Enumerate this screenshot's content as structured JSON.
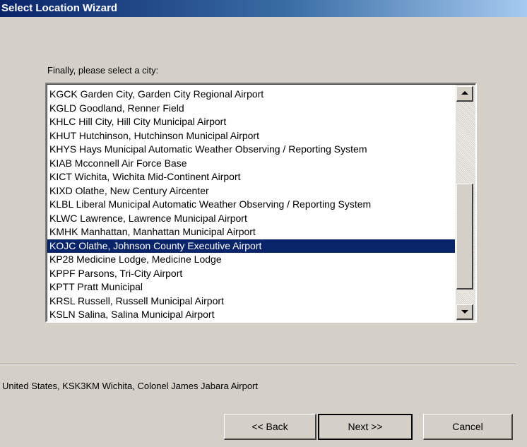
{
  "window": {
    "title": "Select Location Wizard"
  },
  "prompt": "Finally, please select a city:",
  "cities": [
    {
      "label": "KGCK Garden City, Garden City Regional Airport",
      "selected": false
    },
    {
      "label": "KGLD Goodland, Renner Field",
      "selected": false
    },
    {
      "label": "KHLC Hill City, Hill City Municipal Airport",
      "selected": false
    },
    {
      "label": "KHUT Hutchinson, Hutchinson Municipal Airport",
      "selected": false
    },
    {
      "label": "KHYS Hays Municipal Automatic Weather Observing / Reporting System",
      "selected": false
    },
    {
      "label": "KIAB Mcconnell Air Force Base",
      "selected": false
    },
    {
      "label": "KICT Wichita, Wichita Mid-Continent Airport",
      "selected": false
    },
    {
      "label": "KIXD Olathe, New Century Aircenter",
      "selected": false
    },
    {
      "label": "KLBL Liberal Municipal Automatic Weather Observing / Reporting System",
      "selected": false
    },
    {
      "label": "KLWC Lawrence, Lawrence Municipal Airport",
      "selected": false
    },
    {
      "label": "KMHK Manhattan, Manhattan Municipal Airport",
      "selected": false
    },
    {
      "label": "KOJC Olathe, Johnson County Executive Airport",
      "selected": true
    },
    {
      "label": "KP28 Medicine Lodge, Medicine Lodge",
      "selected": false
    },
    {
      "label": "KPPF Parsons, Tri-City Airport",
      "selected": false
    },
    {
      "label": "KPTT Pratt Municipal",
      "selected": false
    },
    {
      "label": "KRSL Russell, Russell Municipal Airport",
      "selected": false
    },
    {
      "label": "KSLN Salina, Salina Municipal Airport",
      "selected": false
    }
  ],
  "status_text": "United States, KSK3KM Wichita, Colonel James Jabara Airport",
  "buttons": {
    "back": "<< Back",
    "next": "Next >>",
    "cancel": "Cancel"
  },
  "colors": {
    "selection": "#0a246a",
    "face": "#d4d0c8",
    "title_start": "#0a246a",
    "title_end": "#a6caf0"
  }
}
